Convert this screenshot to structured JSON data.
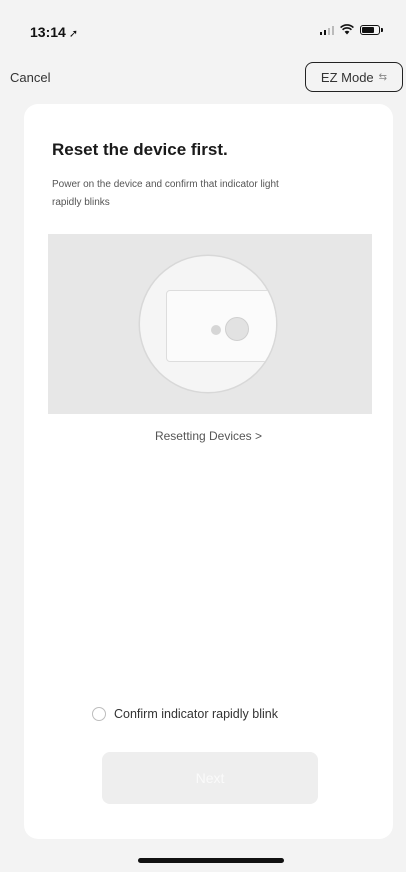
{
  "status_bar": {
    "time": "13:14",
    "location_icon": "location-arrow-icon",
    "signal_icon": "signal-icon",
    "wifi_icon": "wifi-icon",
    "battery_icon": "battery-icon"
  },
  "nav": {
    "cancel_label": "Cancel",
    "mode_label": "EZ Mode",
    "mode_icon": "swap-arrows-icon"
  },
  "main": {
    "title": "Reset the device first.",
    "description": "Power on the device and confirm that indicator light rapidly blinks",
    "help_link": "Resetting Devices >",
    "confirm_label": "Confirm indicator rapidly blink",
    "confirm_checked": false,
    "next_label": "Next"
  },
  "colors": {
    "background": "#f3f3f3",
    "card": "#ffffff",
    "illustration_bg": "#e7e7e7",
    "next_disabled": "#eeeeee"
  }
}
